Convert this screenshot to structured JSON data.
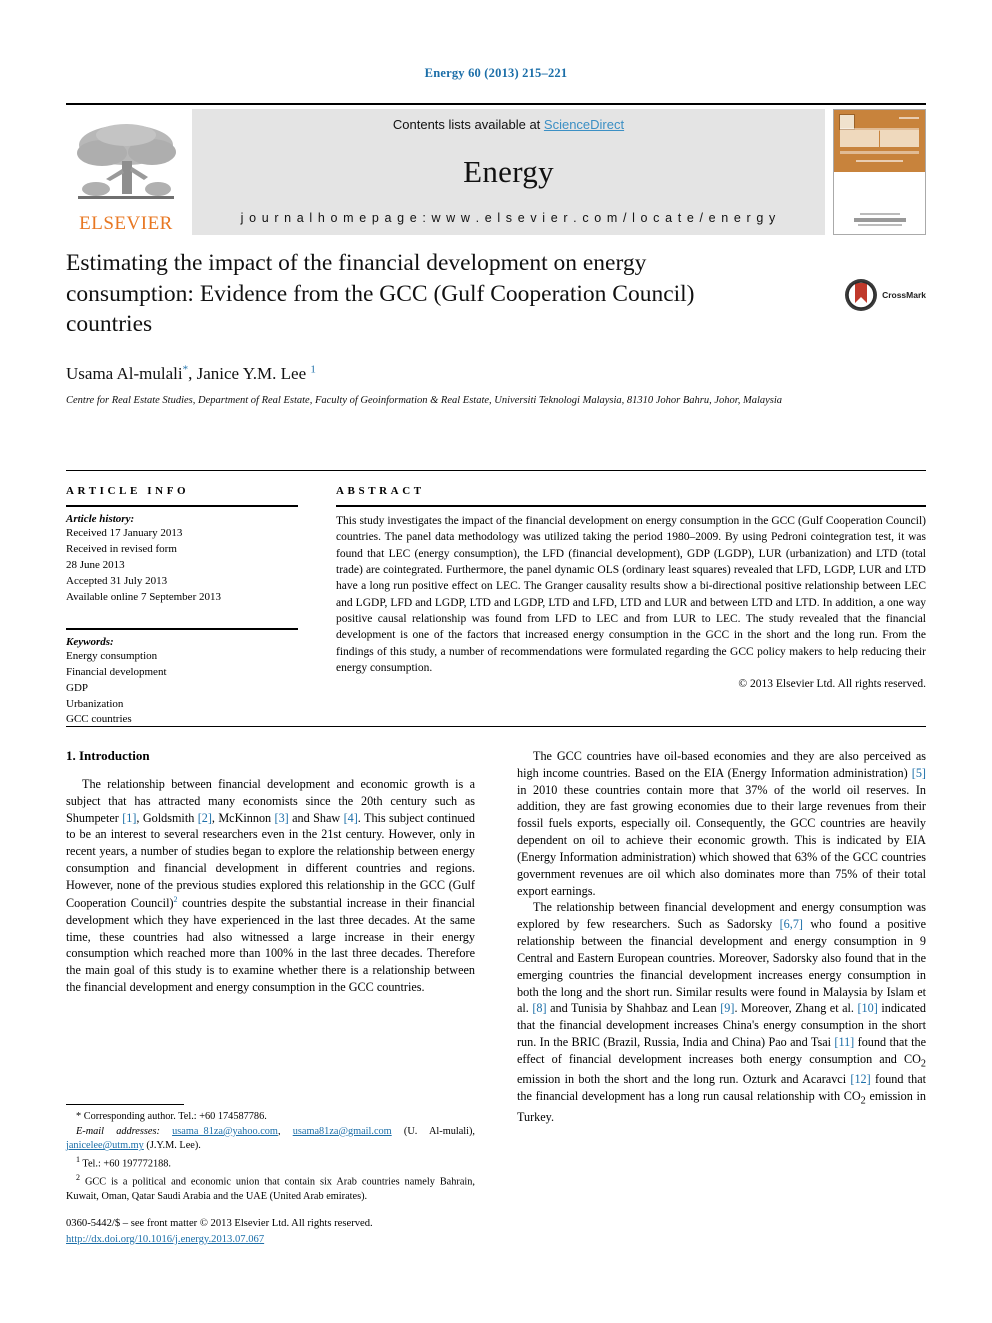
{
  "running_head": "Energy 60 (2013) 215–221",
  "masthead": {
    "contents_prefix": "Contents lists available at ",
    "sciencedirect": "ScienceDirect",
    "journal_name": "Energy",
    "homepage": "j o u r n a l   h o m e p a g e :   w w w . e l s e v i e r . c o m / l o c a t e / e n e r g y",
    "publisher": "ELSEVIER",
    "cover_title": "ENERGY",
    "accent_orange": "#E87722",
    "link_blue": "#3b8fc4",
    "header_grey": "#e4e4e4"
  },
  "article": {
    "title": "Estimating the impact of the financial development on energy consumption: Evidence from the GCC (Gulf Cooperation Council) countries",
    "authors_html": "Usama Al-mulali<sup>*</sup>, Janice Y.M. Lee <sup>1</sup>",
    "affiliation": "Centre for Real Estate Studies, Department of Real Estate, Faculty of Geoinformation & Real Estate, Universiti Teknologi Malaysia, 81310 Johor Bahru, Johor, Malaysia",
    "crossmark_label": "CrossMark"
  },
  "article_info": {
    "heading": "ARTICLE INFO",
    "history_label": "Article history:",
    "history": [
      "Received 17 January 2013",
      "Received in revised form",
      "28 June 2013",
      "Accepted 31 July 2013",
      "Available online 7 September 2013"
    ],
    "keywords_label": "Keywords:",
    "keywords": [
      "Energy consumption",
      "Financial development",
      "GDP",
      "Urbanization",
      "GCC countries"
    ]
  },
  "abstract": {
    "heading": "ABSTRACT",
    "text": "This study investigates the impact of the financial development on energy consumption in the GCC (Gulf Cooperation Council) countries. The panel data methodology was utilized taking the period 1980–2009. By using Pedroni cointegration test, it was found that LEC (energy consumption), the LFD (financial development), GDP (LGDP), LUR (urbanization) and LTD (total trade) are cointegrated. Furthermore, the panel dynamic OLS (ordinary least squares) revealed that LFD, LGDP, LUR and LTD have a long run positive effect on LEC. The Granger causality results show a bi-directional positive relationship between LEC and LGDP, LFD and LGDP, LTD and LGDP, LTD and LFD, LTD and LUR and between LTD and LTD. In addition, a one way positive causal relationship was found from LFD to LEC and from LUR to LEC. The study revealed that the financial development is one of the factors that increased energy consumption in the GCC in the short and the long run. From the findings of this study, a number of recommendations were formulated regarding the GCC policy makers to help reducing their energy consumption.",
    "copyright": "© 2013 Elsevier Ltd. All rights reserved."
  },
  "body": {
    "section_number_title": "1. Introduction",
    "left_paragraphs": [
      "The relationship between financial development and economic growth is a subject that has attracted many economists since the 20th century such as Shumpeter [1], Goldsmith [2], McKinnon [3] and Shaw [4]. This subject continued to be an interest to several researchers even in the 21st century. However, only in recent years, a number of studies began to explore the relationship between energy consumption and financial development in different countries and regions. However, none of the previous studies explored this relationship in the GCC (Gulf Cooperation Council)2 countries despite the substantial increase in their financial development which they have experienced in the last three decades. At the same time, these countries had also witnessed a large increase in their energy consumption which reached more than 100% in the last three decades. Therefore the main goal of this study is to examine whether there is a relationship between the financial development and energy consumption in the GCC countries."
    ],
    "right_paragraphs": [
      "The GCC countries have oil-based economies and they are also perceived as high income countries. Based on the EIA (Energy Information administration) [5] in 2010 these countries contain more that 37% of the world oil reserves. In addition, they are fast growing economies due to their large revenues from their fossil fuels exports, especially oil. Consequently, the GCC countries are heavily dependent on oil to achieve their economic growth. This is indicated by EIA (Energy Information administration) which showed that 63% of the GCC countries government revenues are oil which also dominates more than 75% of their total export earnings.",
      "The relationship between financial development and energy consumption was explored by few researchers. Such as Sadorsky [6,7] who found a positive relationship between the financial development and energy consumption in 9 Central and Eastern European countries. Moreover, Sadorsky also found that in the emerging countries the financial development increases energy consumption in both the long and the short run. Similar results were found in Malaysia by Islam et al. [8] and Tunisia by Shahbaz and Lean [9]. Moreover, Zhang et al. [10] indicated that the financial development increases China's energy consumption in the short run. In the BRIC (Brazil, Russia, India and China) Pao and Tsai [11] found that the effect of financial development increases both energy consumption and CO2 emission in both the short and the long run. Ozturk and Acaravci [12] found that the financial development has a long run causal relationship with CO2 emission in Turkey."
    ]
  },
  "footnotes": {
    "corresponding": "* Corresponding author. Tel.: +60 174587786.",
    "email_label": "E-mail addresses:",
    "email1": "usama_81za@yahoo.com",
    "email2": "usama81za@gmail.com",
    "email1_owner": "(U. Al-mulali),",
    "email3": "janicelee@utm.my",
    "email3_owner": "(J.Y.M. Lee).",
    "fn1": "1 Tel.: +60 197772188.",
    "fn2": "2 GCC is a political and economic union that contain six Arab countries namely Bahrain, Kuwait, Oman, Qatar Saudi Arabia and the UAE (United Arab emirates)."
  },
  "imprint": {
    "issn_line": "0360-5442/$ – see front matter © 2013 Elsevier Ltd. All rights reserved.",
    "doi": "http://dx.doi.org/10.1016/j.energy.2013.07.067"
  }
}
